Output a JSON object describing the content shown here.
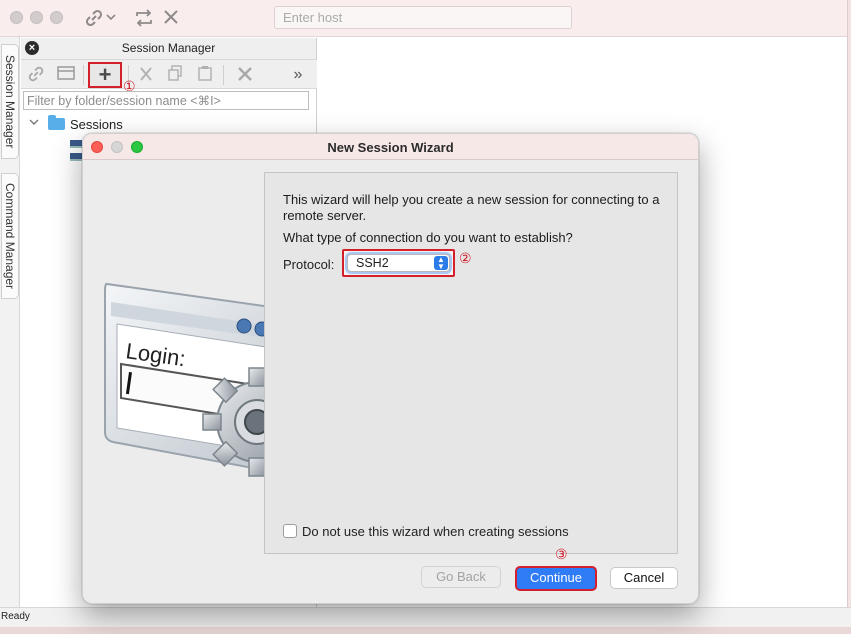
{
  "app": {
    "host_placeholder": "Enter host",
    "status": "Ready",
    "toolbar_icons": [
      "link-icon",
      "chevron-down-icon",
      "repeat-icon",
      "close-icon"
    ]
  },
  "side_tabs": [
    "Session Manager",
    "Command Manager"
  ],
  "session_manager": {
    "title": "Session Manager",
    "filter_placeholder": "Filter by folder/session name <⌘I>",
    "tools": [
      "link-icon",
      "window-icon",
      "add-icon",
      "cut-icon",
      "copy-icon",
      "paste-icon",
      "delete-icon",
      "more-icon"
    ],
    "tree": {
      "root": "Sessions"
    }
  },
  "markers": {
    "one": "①",
    "two": "②",
    "three": "③"
  },
  "wizard": {
    "title": "New Session Wizard",
    "intro": "This wizard will help you create a new session for connecting to a remote server.",
    "question": "What type of connection do you want to establish?",
    "protocol_label": "Protocol:",
    "protocol_value": "SSH2",
    "checkbox_label": "Do not use this wizard when creating sessions",
    "checkbox_checked": false,
    "buttons": {
      "back": "Go Back",
      "continue": "Continue",
      "cancel": "Cancel"
    },
    "illustration_text": "Login:"
  },
  "colors": {
    "accent": "#2f7cf6",
    "highlight": "#d3202b",
    "folder": "#58aee9"
  }
}
